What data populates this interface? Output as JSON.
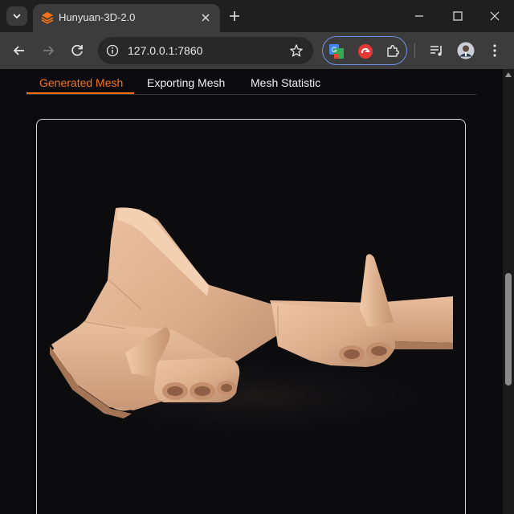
{
  "browser": {
    "tab_title": "Hunyuan-3D-2.0",
    "url": "127.0.0.1:7860"
  },
  "page": {
    "tabs": [
      {
        "label": "Generated Mesh",
        "active": true
      },
      {
        "label": "Exporting Mesh",
        "active": false
      },
      {
        "label": "Mesh Statistic",
        "active": false
      }
    ],
    "accent_color": "#f97316",
    "viewer_content": "3d-airplane-mesh"
  }
}
